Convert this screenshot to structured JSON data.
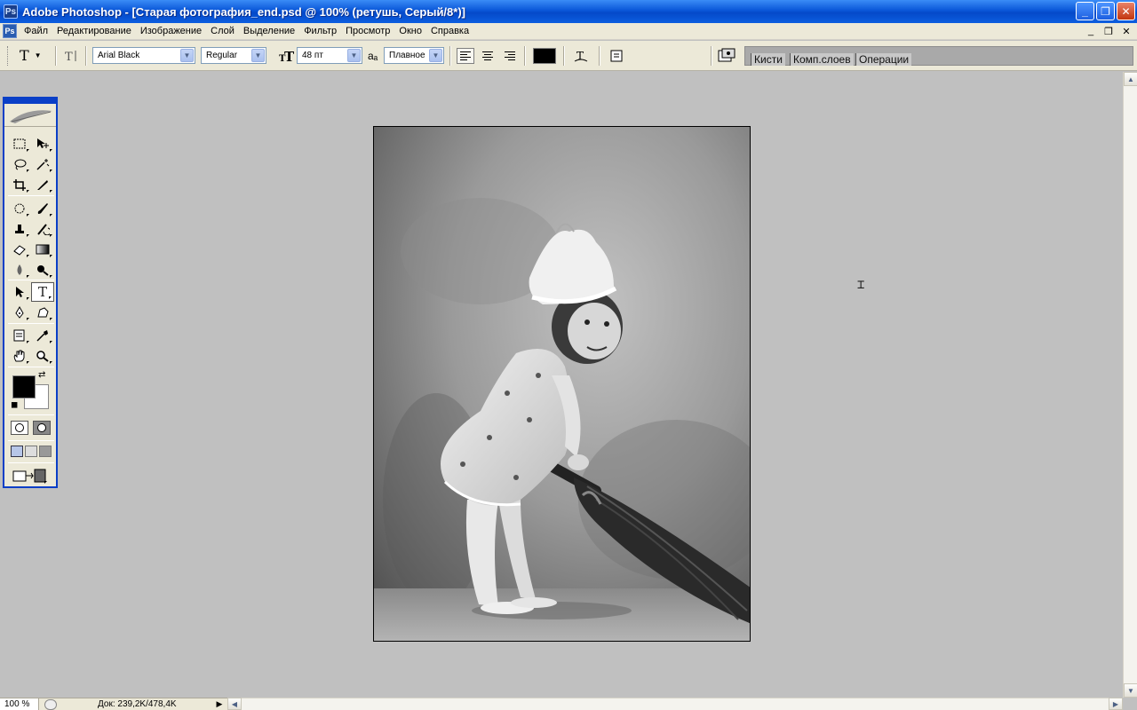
{
  "window": {
    "title": "Adobe Photoshop - [Старая фотография_end.psd @ 100% (ретушь, Серый/8*)]",
    "minimize": "_",
    "maximize": "❐",
    "close": "✕"
  },
  "menu": {
    "items": [
      "Файл",
      "Редактирование",
      "Изображение",
      "Слой",
      "Выделение",
      "Фильтр",
      "Просмотр",
      "Окно",
      "Справка"
    ],
    "doc_min": "_",
    "doc_restore": "❐",
    "doc_close": "✕"
  },
  "options": {
    "tool_glyph": "T",
    "font_family": "Arial Black",
    "font_style": "Regular",
    "font_size": "48 пт",
    "aa_label": "aₐ",
    "antialias": "Плавное",
    "text_color": "#000000"
  },
  "palette_well": {
    "tabs": [
      "Кисти",
      "Комп.слоев",
      "Операции"
    ]
  },
  "toolbox": {
    "fg_color": "#000000",
    "bg_color": "#ffffff"
  },
  "status": {
    "zoom": "100 %",
    "doc_info": "Док: 239,2K/478,4K"
  },
  "document": {
    "image_description": "Old black-and-white photograph of a small girl in a white bonnet and dress holding a broom"
  }
}
